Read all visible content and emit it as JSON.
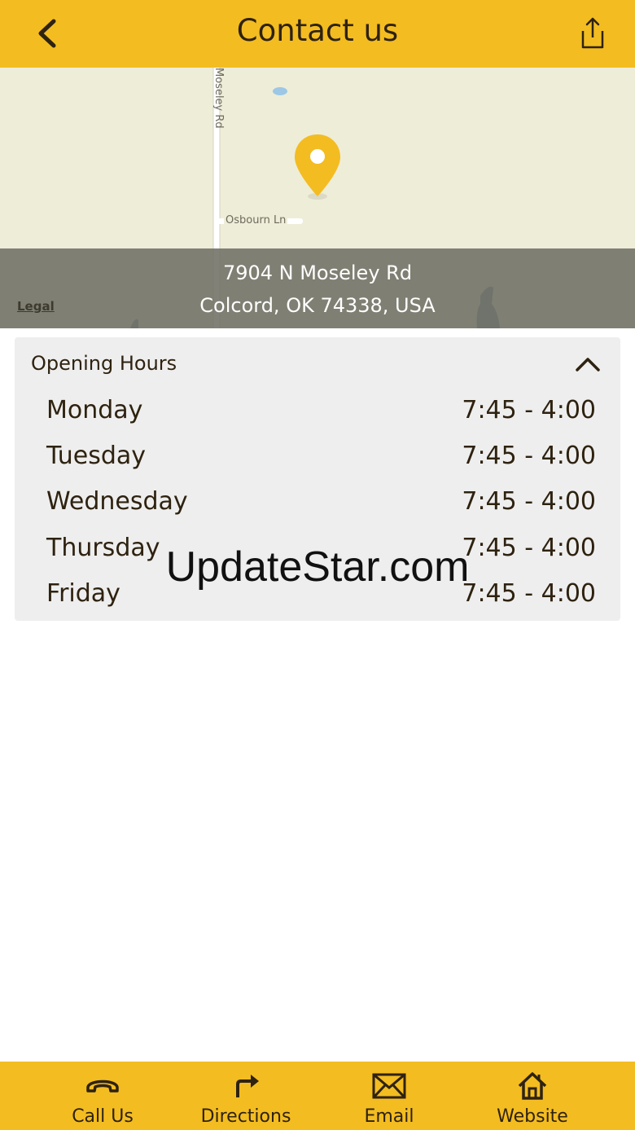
{
  "header": {
    "title": "Contact us"
  },
  "map": {
    "road_vertical": "Moseley Rd",
    "road_horizontal": "Osbourn Ln",
    "legal_link": "Legal",
    "address_line1": "7904 N Moseley Rd",
    "address_line2": "Colcord, OK 74338, USA",
    "pin_color": "#f3bc21"
  },
  "hours": {
    "title": "Opening Hours",
    "days": [
      {
        "day": "Monday",
        "time": "7:45 - 4:00"
      },
      {
        "day": "Tuesday",
        "time": "7:45 - 4:00"
      },
      {
        "day": "Wednesday",
        "time": "7:45 - 4:00"
      },
      {
        "day": "Thursday",
        "time": "7:45 - 4:00"
      },
      {
        "day": "Friday",
        "time": "7:45 - 4:00"
      }
    ]
  },
  "watermark": "UpdateStar.com",
  "bottom_nav": [
    {
      "label": "Call Us",
      "icon": "phone-icon"
    },
    {
      "label": "Directions",
      "icon": "directions-arrow-icon"
    },
    {
      "label": "Email",
      "icon": "envelope-icon"
    },
    {
      "label": "Website",
      "icon": "home-icon"
    }
  ],
  "colors": {
    "accent": "#f3bc21",
    "text": "#2e2210"
  }
}
